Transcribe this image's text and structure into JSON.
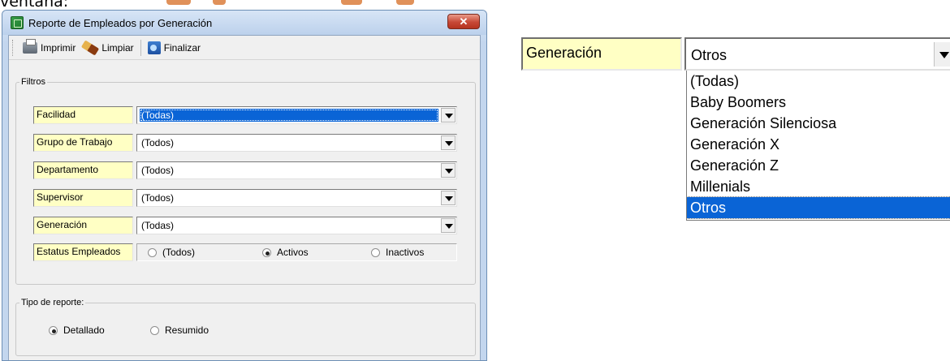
{
  "caption": "ventana:",
  "window": {
    "title": "Reporte de Empleados por Generación",
    "close_glyph": "✕"
  },
  "toolbar": {
    "print_label": "Imprimir",
    "clear_label": "Limpiar",
    "finish_label": "Finalizar"
  },
  "filters": {
    "legend": "Filtros",
    "rows": [
      {
        "label": "Facilidad",
        "value": "(Todas)"
      },
      {
        "label": "Grupo de Trabajo",
        "value": "(Todos)"
      },
      {
        "label": "Departamento",
        "value": "(Todos)"
      },
      {
        "label": "Supervisor",
        "value": "(Todos)"
      },
      {
        "label": "Generación",
        "value": "(Todas)"
      }
    ],
    "status": {
      "label": "Estatus Empleados",
      "options": [
        "(Todos)",
        "Activos",
        "Inactivos"
      ],
      "selected": "Activos"
    }
  },
  "report_type": {
    "legend": "Tipo de reporte:",
    "options": [
      "Detallado",
      "Resumido"
    ],
    "selected": "Detallado"
  },
  "zoom_dropdown": {
    "label": "Generación",
    "value": "Otros",
    "options": [
      "(Todas)",
      "Baby Boomers",
      "Generación Silenciosa",
      "Generación X",
      "Generación Z",
      "Millenials",
      "Otros"
    ],
    "selected": "Otros"
  },
  "colors": {
    "label_bg": "#ffffc4",
    "selection": "#0a64d6",
    "close_button": "#c74836"
  }
}
